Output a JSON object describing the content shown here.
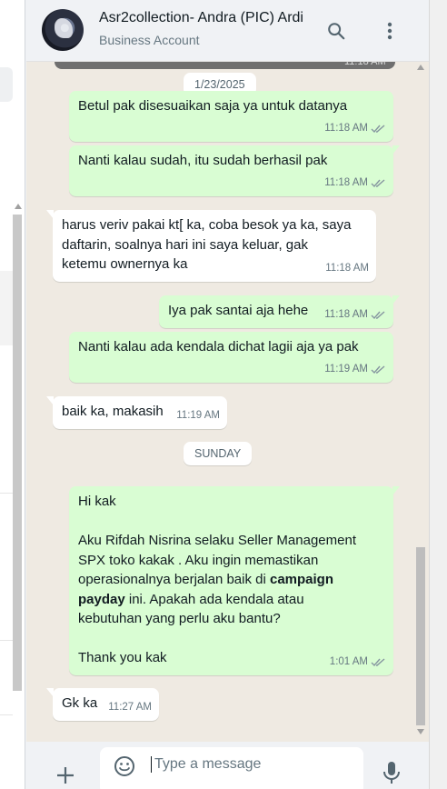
{
  "header": {
    "contact_name": "Asr2collection- Andra (PIC) Ardi",
    "account_type": "Business Account"
  },
  "icons": {
    "avatar": "avatar-image",
    "search": "search-icon",
    "menu": "kebab-menu-icon",
    "add": "plus-icon",
    "emoji": "emoji-icon",
    "mic": "mic-icon",
    "read": "double-check-icon"
  },
  "colors": {
    "outgoing_bubble": "#d9fdd3",
    "incoming_bubble": "#ffffff",
    "chat_background": "#efeae2",
    "read_tick": "#8696a0"
  },
  "previous_message_time": "11:18 AM",
  "messages": [
    {
      "type": "date",
      "text": "1/23/2025"
    },
    {
      "type": "out",
      "text": "Betul pak disesuaikan saja ya untuk datanya",
      "time": "11:18 AM"
    },
    {
      "type": "out",
      "text": "Nanti kalau sudah, itu sudah berhasil pak",
      "time": "11:18 AM"
    },
    {
      "type": "in",
      "lines": [
        "harus veriv pakai kt[ ka, coba besok ya ka, saya",
        "daftarin, soalnya hari ini saya keluar, gak",
        "ketemu ownernya ka"
      ],
      "time": "11:18 AM"
    },
    {
      "type": "out",
      "text": "Iya pak santai aja hehe",
      "time": "11:18 AM"
    },
    {
      "type": "out",
      "text": "Nanti kalau ada kendala dichat lagii aja ya pak",
      "time": "11:19 AM"
    },
    {
      "type": "in",
      "text": "baik ka, makasih",
      "time": "11:19 AM"
    },
    {
      "type": "date",
      "text": "SUNDAY"
    },
    {
      "type": "out",
      "greeting": "Hi kak",
      "lines": [
        "Aku Rifdah Nisrina selaku Seller Management",
        "SPX toko kakak . Aku ingin memastikan",
        "operasionalnya berjalan baik di"
      ],
      "bold_1": "campaign",
      "bold_2": "payday",
      "line_after_bold": "ini. Apakah ada kendala atau",
      "last_line": "kebutuhan yang perlu aku bantu?",
      "closing": "Thank you kak",
      "time": "1:01 AM"
    },
    {
      "type": "in",
      "text": "Gk ka",
      "time": "11:27 AM"
    }
  ],
  "composer": {
    "placeholder": "Type a message"
  }
}
